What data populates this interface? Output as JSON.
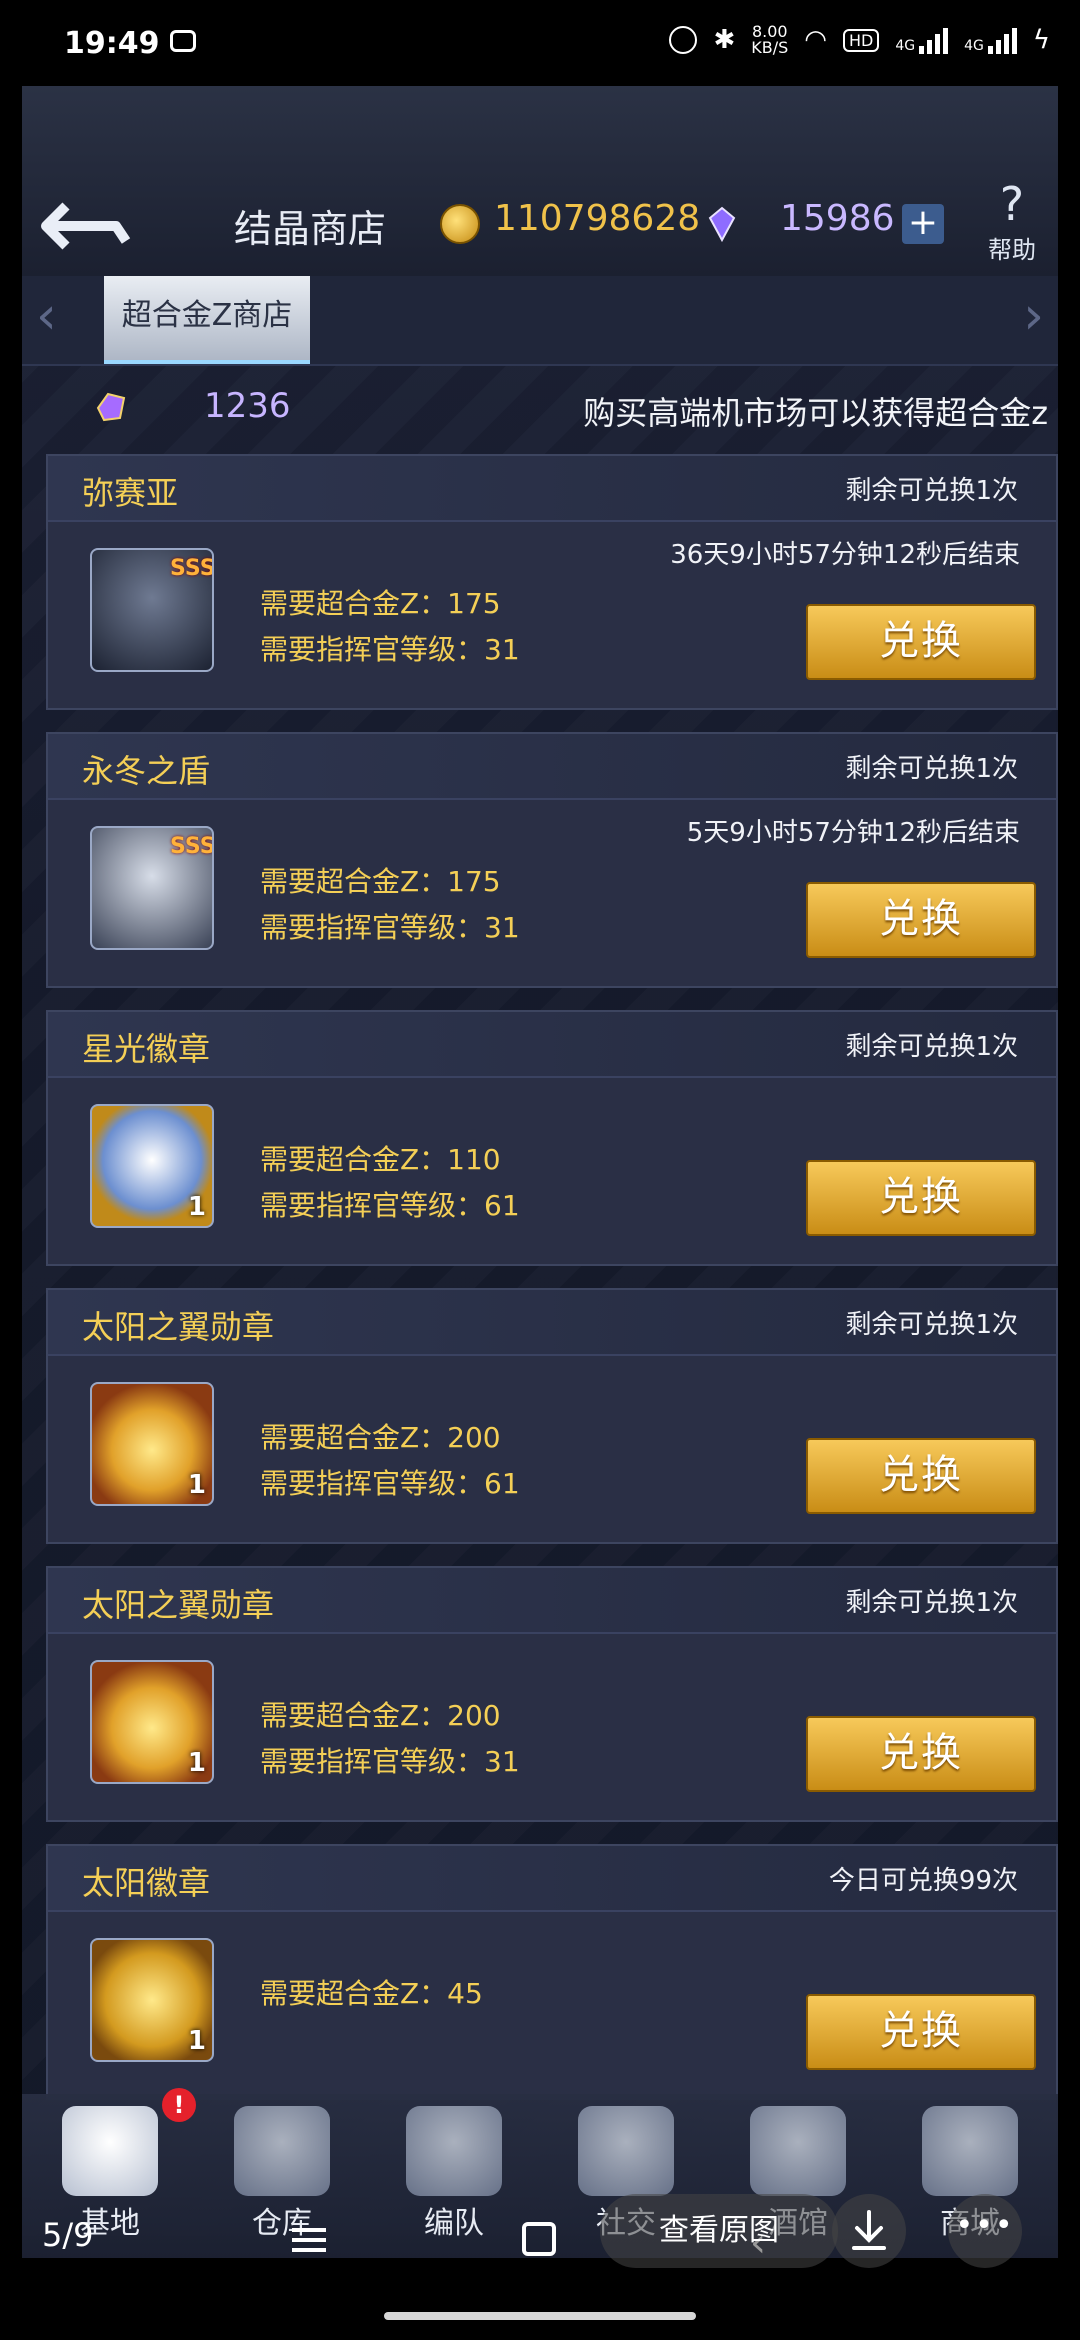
{
  "status_bar": {
    "time": "19:49",
    "net_speed": "8.00",
    "net_unit": "KB/S",
    "hd": "HD",
    "sig1": "4G",
    "sig2": "4G"
  },
  "header": {
    "title": "结晶商店",
    "gold": "110798628",
    "gems": "15986",
    "plus": "+",
    "help": "帮助",
    "help_symbol": "?"
  },
  "tabs": {
    "active": "超合金Z商店",
    "left_arrow": "‹",
    "right_arrow": "›"
  },
  "currency": {
    "crystal": "1236",
    "hint": "购买高端机市场可以获得超合金z"
  },
  "items": [
    {
      "name": "弥赛亚",
      "remain": "剩余可兑换1次",
      "end": "36天9小时57分钟12秒后结束",
      "req1": "需要超合金Z：175",
      "req2": "需要指挥官等级：31",
      "badge": "SSS",
      "count": "",
      "button": "兑换"
    },
    {
      "name": "永冬之盾",
      "remain": "剩余可兑换1次",
      "end": "5天9小时57分钟12秒后结束",
      "req1": "需要超合金Z：175",
      "req2": "需要指挥官等级：31",
      "badge": "SSS",
      "count": "",
      "button": "兑换"
    },
    {
      "name": "星光徽章",
      "remain": "剩余可兑换1次",
      "end": "",
      "req1": "需要超合金Z：110",
      "req2": "需要指挥官等级：61",
      "badge": "",
      "count": "1",
      "button": "兑换"
    },
    {
      "name": "太阳之翼勋章",
      "remain": "剩余可兑换1次",
      "end": "",
      "req1": "需要超合金Z：200",
      "req2": "需要指挥官等级：61",
      "badge": "",
      "count": "1",
      "button": "兑换"
    },
    {
      "name": "太阳之翼勋章",
      "remain": "剩余可兑换1次",
      "end": "",
      "req1": "需要超合金Z：200",
      "req2": "需要指挥官等级：31",
      "badge": "",
      "count": "1",
      "button": "兑换"
    },
    {
      "name": "太阳徽章",
      "remain": "今日可兑换99次",
      "end": "",
      "req1": "需要超合金Z：45",
      "req2": "",
      "badge": "",
      "count": "1",
      "button": "兑换"
    }
  ],
  "bottom_nav": {
    "items": [
      {
        "label": "基地"
      },
      {
        "label": "仓库"
      },
      {
        "label": "编队"
      },
      {
        "label": "社交"
      },
      {
        "label": "酒馆"
      },
      {
        "label": "商城"
      }
    ],
    "alert": "!"
  },
  "viewer": {
    "page": "5/9",
    "view_original": "查看原图",
    "more": "•••"
  }
}
